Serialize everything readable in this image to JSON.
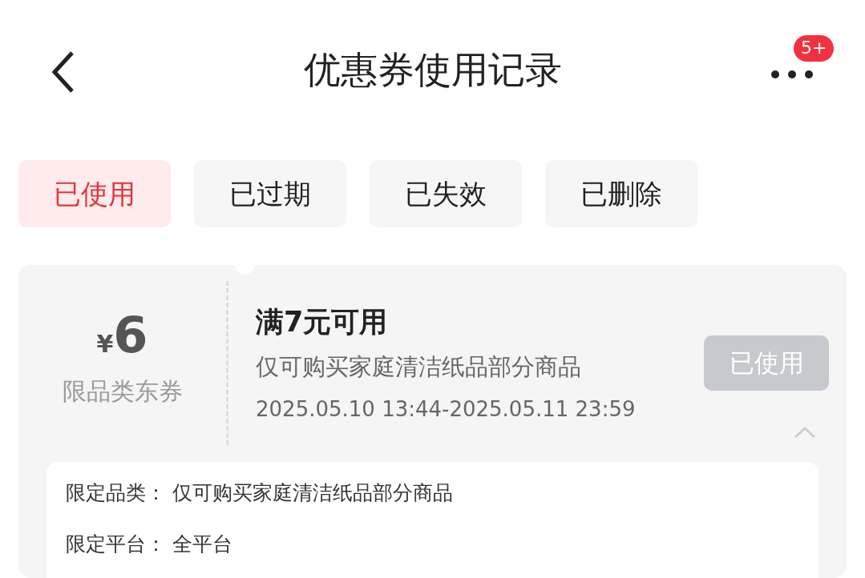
{
  "header": {
    "title": "优惠券使用记录",
    "badge": "5+"
  },
  "tabs": [
    {
      "label": "已使用",
      "selected": true
    },
    {
      "label": "已过期",
      "selected": false
    },
    {
      "label": "已失效",
      "selected": false
    },
    {
      "label": "已删除",
      "selected": false
    }
  ],
  "coupon": {
    "currency": "¥",
    "amount": "6",
    "type": "限品类东券",
    "condition": "满7元可用",
    "scope": "仅可购买家庭清洁纸品部分商品",
    "validity": "2025.05.10 13:44-2025.05.11 23:59",
    "status": "已使用",
    "expanded": true,
    "details": [
      {
        "label": "限定品类：",
        "value": "仅可购买家庭清洁纸品部分商品"
      },
      {
        "label": "限定平台：",
        "value": "全平台"
      }
    ]
  }
}
